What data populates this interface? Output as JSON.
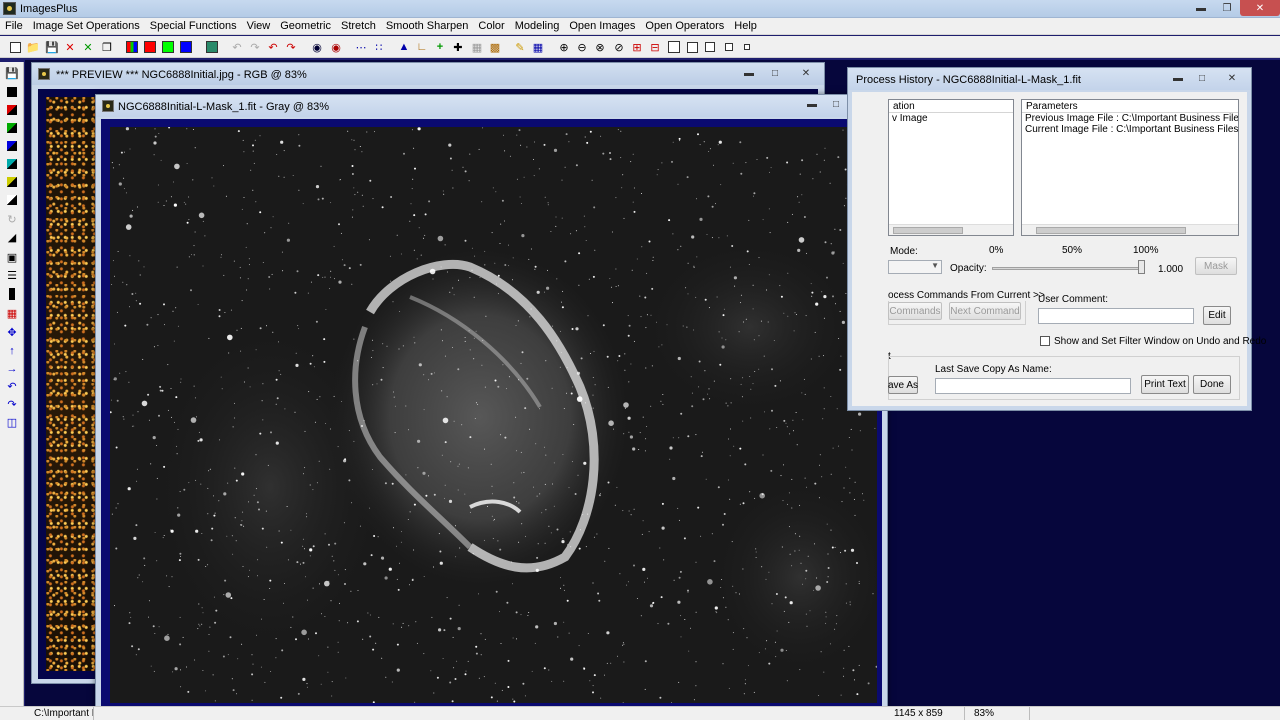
{
  "app": {
    "title": "ImagesPlus"
  },
  "menu": [
    "File",
    "Image Set Operations",
    "Special Functions",
    "View",
    "Geometric",
    "Stretch",
    "Smooth Sharpen",
    "Color",
    "Modeling",
    "Open Images",
    "Open Operators",
    "Help"
  ],
  "preview_window": {
    "title": "*** PREVIEW *** NGC6888Initial.jpg - RGB @ 83%"
  },
  "image_window": {
    "title": "NGC6888Initial-L-Mask_1.fit - Gray @ 83%"
  },
  "process_history": {
    "title": "Process History - NGC6888Initial-L-Mask_1.fit",
    "operation_header": "ation",
    "operation_row": "v Image",
    "parameters_header": "Parameters",
    "param_rows": [
      "Previous Image File : C:\\Important Business Files\\WW...",
      "Current Image File : C:\\Important Business Files\\WW..."
    ],
    "mode_label": "Mode:",
    "opacity_label": "Opacity:",
    "opacity_ticks": [
      "0%",
      "50%",
      "100%"
    ],
    "opacity_value": "1.000",
    "opacity_level": 1.0,
    "mask_button": "Mask",
    "process_commands_label": "ocess Commands From Current >>",
    "commands_button": "Commands",
    "next_command_button": "Next Command",
    "user_comment_label": "User Comment:",
    "edit_button": "Edit",
    "show_filter_label": "Show and Set Filter Window on Undo and Redo",
    "group_fragment": "t",
    "save_as_button": "ave As",
    "last_save_label": "Last Save Copy As Name:",
    "print_text_button": "Print Text",
    "done_button": "Done"
  },
  "status": {
    "path": "C:\\Important B",
    "dimensions": "1145 x 859",
    "zoom": "83%"
  }
}
